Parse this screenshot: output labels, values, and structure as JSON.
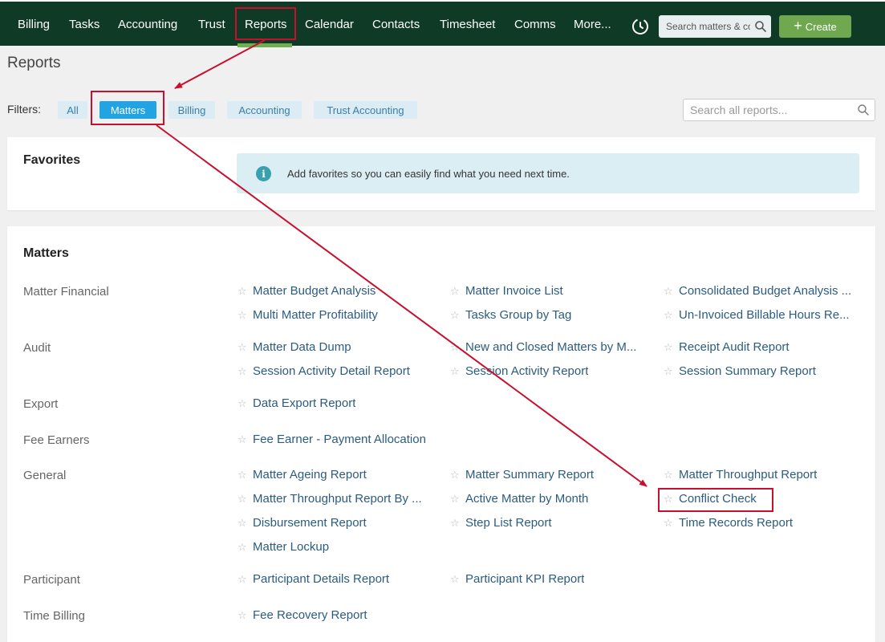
{
  "nav": {
    "items": [
      "Billing",
      "Tasks",
      "Accounting",
      "Trust",
      "Reports",
      "Calendar",
      "Contacts",
      "Timesheet",
      "Comms",
      "More..."
    ],
    "search_placeholder": "Search matters & co",
    "create_label": "Create",
    "active": "Reports",
    "brand_color": "#0f3a26",
    "accent_color": "#6fae51"
  },
  "page": {
    "title": "Reports",
    "filters_label": "Filters:",
    "filters": [
      "All",
      "Matters",
      "Billing",
      "Accounting",
      "Trust Accounting"
    ],
    "active_filter": "Matters",
    "search_placeholder": "Search all reports..."
  },
  "favorites": {
    "heading": "Favorites",
    "info_icon": "i",
    "info_text": "Add favorites so you can easily find what you need next time."
  },
  "matters": {
    "heading": "Matters",
    "categories": [
      {
        "label": "Matter Financial",
        "reports": [
          "Matter Budget Analysis",
          "Matter Invoice List",
          "Consolidated Budget Analysis ...",
          "Multi Matter Profitability",
          "Tasks Group by Tag",
          "Un-Invoiced Billable Hours Re..."
        ]
      },
      {
        "label": "Audit",
        "reports": [
          "Matter Data Dump",
          "New and Closed Matters by M...",
          "Receipt Audit Report",
          "Session Activity Detail Report",
          "Session Activity Report",
          "Session Summary Report"
        ]
      },
      {
        "label": "Export",
        "reports": [
          "Data Export Report"
        ]
      },
      {
        "label": "Fee Earners",
        "reports": [
          "Fee Earner - Payment Allocation"
        ]
      },
      {
        "label": "General",
        "reports": [
          "Matter Ageing Report",
          "Matter Summary Report",
          "Matter Throughput Report",
          "Matter Throughput Report By ...",
          "Active Matter by Month",
          "Conflict Check",
          "Disbursement Report",
          "Step List Report",
          "Time Records Report",
          "Matter Lockup"
        ]
      },
      {
        "label": "Participant",
        "reports": [
          "Participant Details Report",
          "Participant KPI Report"
        ]
      },
      {
        "label": "Time Billing",
        "reports": [
          "Fee Recovery Report"
        ]
      }
    ]
  },
  "annotation": {
    "color": "#c8102e"
  }
}
